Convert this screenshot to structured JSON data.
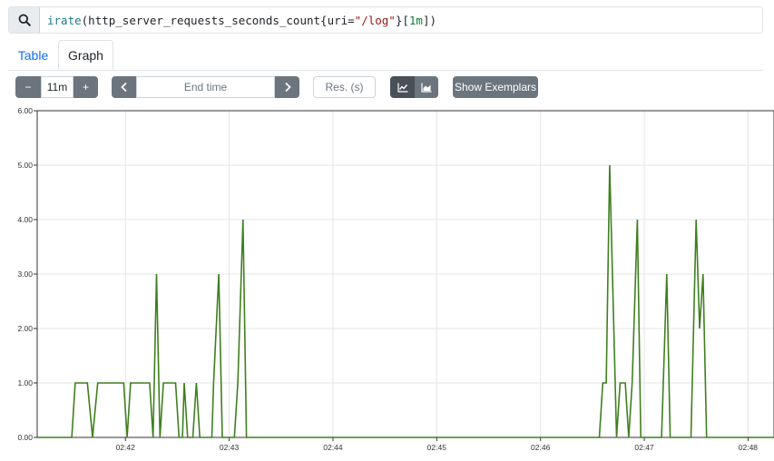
{
  "query": {
    "tokens": [
      {
        "text": "irate",
        "kind": "fn"
      },
      {
        "text": "(http_server_requests_seconds_count{uri=",
        "kind": "plain"
      },
      {
        "text": "\"/log\"",
        "kind": "str"
      },
      {
        "text": "}[",
        "kind": "plain"
      },
      {
        "text": "1m",
        "kind": "num"
      },
      {
        "text": "])",
        "kind": "plain"
      }
    ],
    "search_icon": "search-icon"
  },
  "tabs": {
    "table": "Table",
    "graph": "Graph",
    "active": "graph"
  },
  "controls": {
    "minus_label": "−",
    "range_value": "11m",
    "plus_label": "+",
    "end_time_placeholder": "End time",
    "resolution_placeholder": "Res. (s)",
    "show_exemplars_label": "Show Exemplars",
    "back_icon": "chevron-left-icon",
    "forward_icon": "chevron-right-icon",
    "line_chart_icon": "line-chart-icon",
    "stacked_chart_icon": "area-chart-icon"
  },
  "colors": {
    "series": "#3f7f1f",
    "grid": "#e5e5e5",
    "axis": "#333333",
    "button": "#6c757d",
    "button_active": "#495057",
    "link": "#0d6efd"
  },
  "chart_data": {
    "type": "line",
    "title": "",
    "xlabel": "",
    "ylabel": "",
    "ylim": [
      0,
      6
    ],
    "y_ticks": [
      "0.00",
      "1.00",
      "2.00",
      "3.00",
      "4.00",
      "5.00",
      "6.00"
    ],
    "x_ticks": [
      "02:42",
      "02:43",
      "02:44",
      "02:45",
      "02:46",
      "02:47",
      "02:48"
    ],
    "xlim": [
      "02:41:09",
      "02:48:15"
    ],
    "grid": true,
    "series": [
      {
        "points": [
          [
            "02:41:09",
            0
          ],
          [
            "02:41:29",
            0
          ],
          [
            "02:41:31",
            1
          ],
          [
            "02:41:38",
            1
          ],
          [
            "02:41:41",
            0
          ],
          [
            "02:41:44",
            1
          ],
          [
            "02:41:59",
            1
          ],
          [
            "02:42:01",
            0
          ],
          [
            "02:42:03",
            1
          ],
          [
            "02:42:14",
            1
          ],
          [
            "02:42:16",
            0
          ],
          [
            "02:42:18",
            3
          ],
          [
            "02:42:20",
            0
          ],
          [
            "02:42:22",
            1
          ],
          [
            "02:42:29",
            1
          ],
          [
            "02:42:31",
            0
          ],
          [
            "02:42:33",
            0
          ],
          [
            "02:42:34",
            1
          ],
          [
            "02:42:36",
            0
          ],
          [
            "02:42:39",
            0
          ],
          [
            "02:42:41",
            1
          ],
          [
            "02:42:43",
            0
          ],
          [
            "02:42:50",
            0
          ],
          [
            "02:42:51",
            1
          ],
          [
            "02:42:54",
            3
          ],
          [
            "02:42:56",
            0
          ],
          [
            "02:43:03",
            0
          ],
          [
            "02:43:05",
            1
          ],
          [
            "02:43:08",
            4
          ],
          [
            "02:43:10",
            0
          ],
          [
            "02:46:34",
            0
          ],
          [
            "02:46:36",
            1
          ],
          [
            "02:46:38",
            1
          ],
          [
            "02:46:40",
            5
          ],
          [
            "02:46:44",
            0
          ],
          [
            "02:46:46",
            1
          ],
          [
            "02:46:49",
            1
          ],
          [
            "02:46:51",
            0
          ],
          [
            "02:46:53",
            1
          ],
          [
            "02:46:56",
            4
          ],
          [
            "02:46:58",
            0
          ],
          [
            "02:47:10",
            0
          ],
          [
            "02:47:13",
            3
          ],
          [
            "02:47:15",
            0
          ],
          [
            "02:47:27",
            0
          ],
          [
            "02:47:30",
            4
          ],
          [
            "02:47:32",
            2
          ],
          [
            "02:47:34",
            3
          ],
          [
            "02:47:36",
            0
          ],
          [
            "02:48:15",
            0
          ]
        ]
      }
    ]
  }
}
